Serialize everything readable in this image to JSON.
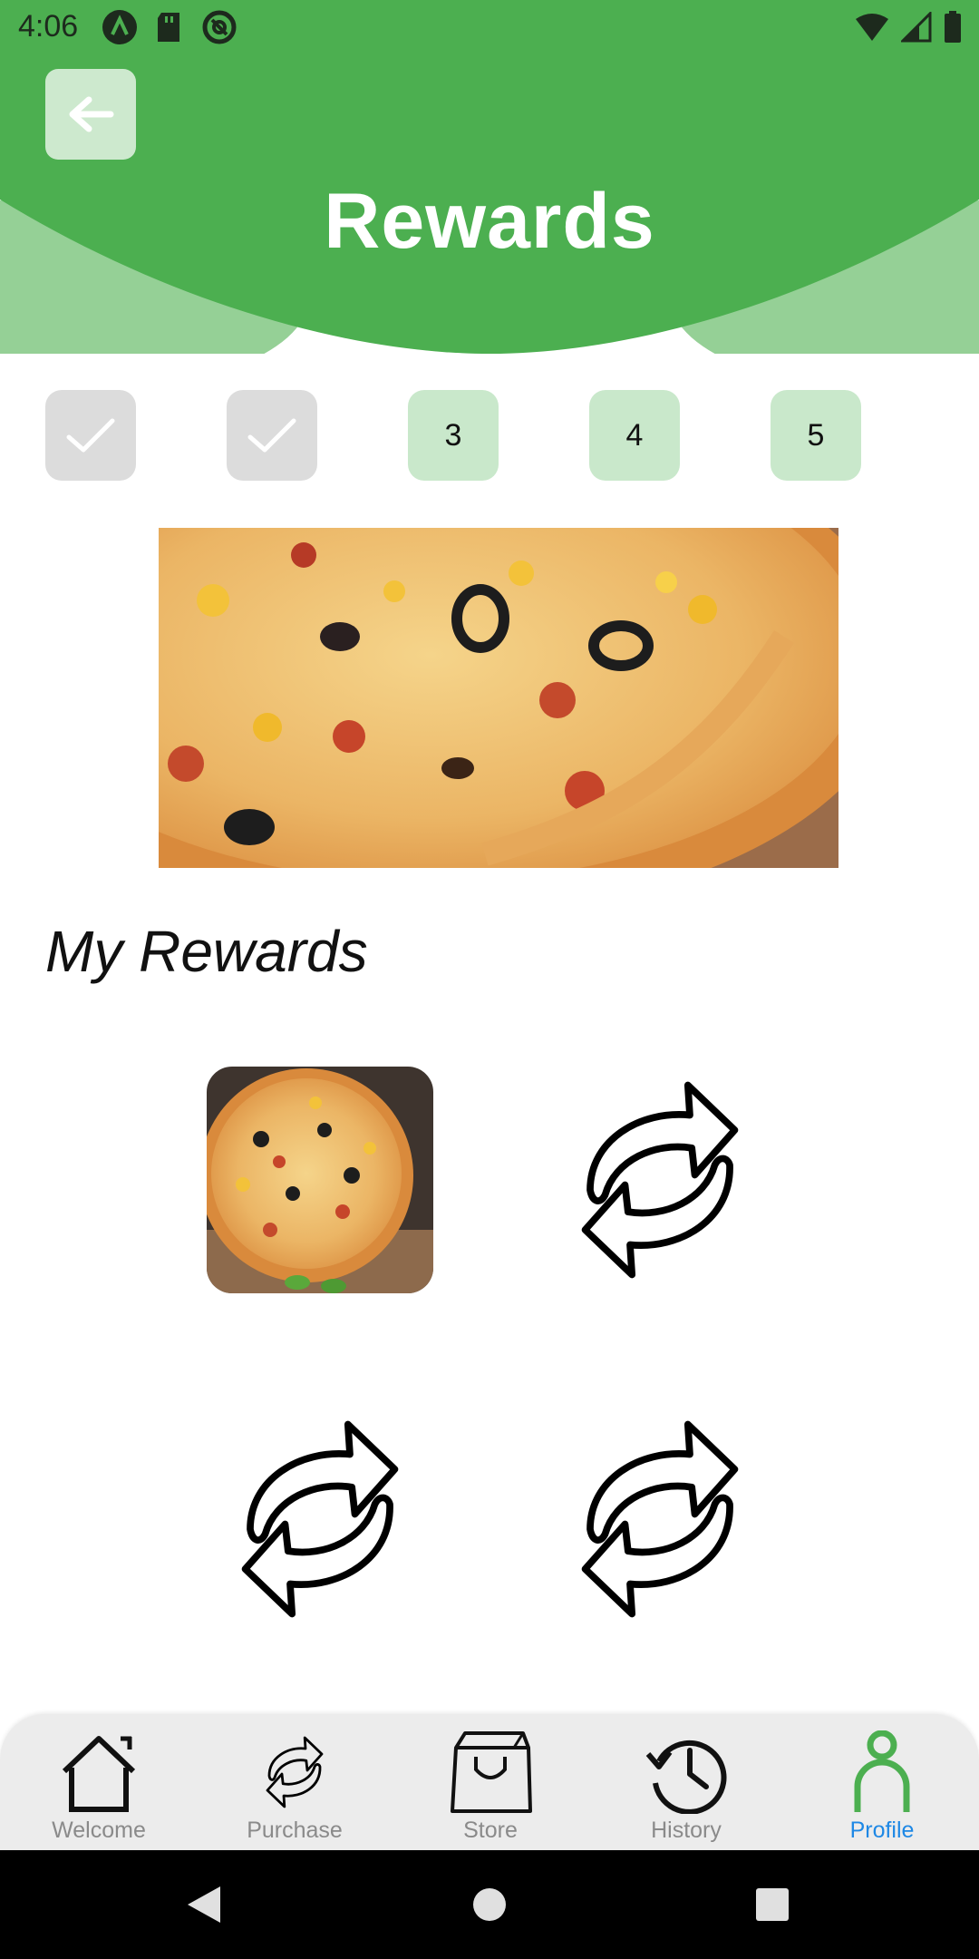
{
  "status_bar": {
    "time": "4:06",
    "left_icons": [
      "app-a-icon",
      "sd-card-icon",
      "at-sign-icon"
    ],
    "right_icons": [
      "wifi-icon",
      "cell-signal-icon",
      "battery-icon"
    ]
  },
  "header": {
    "title": "Rewards",
    "back_icon": "arrow-left-icon",
    "primary_color": "#4caf50",
    "secondary_color": "#95d096"
  },
  "steps": [
    {
      "state": "done",
      "label": ""
    },
    {
      "state": "done",
      "label": ""
    },
    {
      "state": "pending",
      "label": "3"
    },
    {
      "state": "pending",
      "label": "4"
    },
    {
      "state": "pending",
      "label": "5"
    }
  ],
  "hero": {
    "image": "pizza-photo"
  },
  "rewards": {
    "title": "My Rewards",
    "items": [
      "pizza-photo",
      "refresh-arrows-icon",
      "refresh-arrows-icon",
      "refresh-arrows-icon"
    ]
  },
  "bottom_nav": {
    "items": [
      {
        "label": "Welcome",
        "icon": "home-icon",
        "active": false
      },
      {
        "label": "Purchase",
        "icon": "refresh-icon",
        "active": false
      },
      {
        "label": "Store",
        "icon": "shopping-bag-icon",
        "active": false
      },
      {
        "label": "History",
        "icon": "history-icon",
        "active": false
      },
      {
        "label": "Profile",
        "icon": "person-icon",
        "active": true
      }
    ],
    "active_color": "#4caf50",
    "active_label_color": "#1e88e5"
  },
  "system_nav": [
    "back-triangle-icon",
    "home-circle-icon",
    "recents-square-icon"
  ]
}
